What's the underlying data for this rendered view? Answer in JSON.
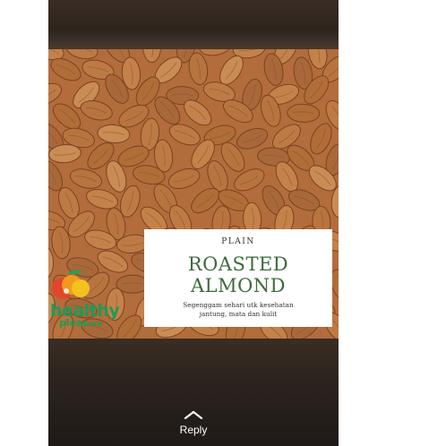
{
  "post": {
    "kicker": "PLAIN",
    "title_line1": "ROASTED",
    "title_line2": "ALMOND",
    "subtitle_line1": "Segenggam sehari utk kesehatan",
    "subtitle_line2": "jantung, mata dan kulit",
    "brand_line1": "healthy",
    "brand_line2": "pleas",
    "brand_line2_small": "ure"
  },
  "reply": {
    "label": "Reply",
    "icon": "chevron-up-icon"
  },
  "colors": {
    "almond": "#b8743f",
    "almond_dark": "#8a4f27",
    "title_green": "#3e6b3c",
    "brand_green": "#1f9a58"
  }
}
